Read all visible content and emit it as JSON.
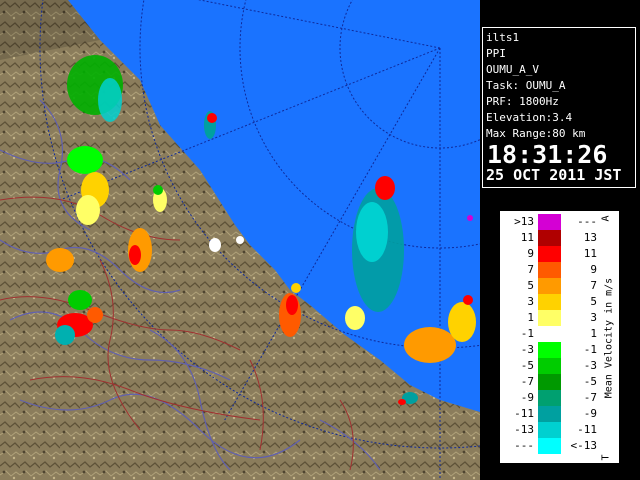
{
  "info": {
    "site": "ilts1",
    "scan_type": "PPI",
    "product": "OUMU_A_V",
    "task": "Task: OUMU_A",
    "prf": "PRF: 1800Hz",
    "elevation": "Elevation:3.4",
    "max_range": "Max Range:80 km",
    "time": "18:31:26",
    "date": "25 OCT 2011 JST"
  },
  "legend": {
    "title": "Mean Velocity in m/s",
    "top_marker": "A",
    "bottom_marker": "T",
    "rows": [
      {
        "left": ">13",
        "right": "---",
        "color": "#d400d4"
      },
      {
        "left": "11",
        "right": "13",
        "color": "#b00000"
      },
      {
        "left": "9",
        "right": "11",
        "color": "#ff0000"
      },
      {
        "left": "7",
        "right": "9",
        "color": "#ff5a00"
      },
      {
        "left": "5",
        "right": "7",
        "color": "#ff9a00"
      },
      {
        "left": "3",
        "right": "5",
        "color": "#ffd200"
      },
      {
        "left": "1",
        "right": "3",
        "color": "#ffff66"
      },
      {
        "left": "-1",
        "right": "1",
        "color": "#ffffff"
      },
      {
        "left": "-3",
        "right": "-1",
        "color": "#00ff00"
      },
      {
        "left": "-5",
        "right": "-3",
        "color": "#00cc00"
      },
      {
        "left": "-7",
        "right": "-5",
        "color": "#009900"
      },
      {
        "left": "-9",
        "right": "-7",
        "color": "#00a070"
      },
      {
        "left": "-11",
        "right": "-9",
        "color": "#00a0a0"
      },
      {
        "left": "-13",
        "right": "-11",
        "color": "#00d0d0"
      },
      {
        "left": "---",
        "right": "<-13",
        "color": "#00ffff"
      }
    ]
  },
  "colors": {
    "sea": "#1a73ff",
    "out_of_range": "#0a2dc8",
    "land": "#8a7a5a",
    "range_rings": "#0f2a9a",
    "rivers": "#5e5ea8",
    "borders": "#9a2a2a"
  }
}
